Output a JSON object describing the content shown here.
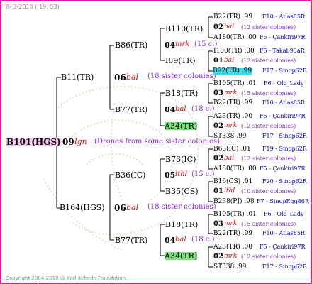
{
  "header_text": "8- 3-2010 ( 19: 53)",
  "footer_text": "Copyright 2004-2010 @ Karl Kehede Foundation.",
  "root": {
    "label": "B101(HGS)",
    "mate_num": "09",
    "mate_mark": "lgn",
    "mate_note": "(Drones from some sister colonies)"
  },
  "gen1": [
    {
      "label": "B11(TR)",
      "mate_num": "06",
      "mate_mark": "bal",
      "mate_note": "(18 sister colonies)"
    },
    {
      "label": "B164(HGS)",
      "mate_num": "06",
      "mate_mark": "bal",
      "mate_note": "(18 sister colonies)"
    }
  ],
  "gen2": [
    {
      "label": "B86(TR)",
      "mate_num": "04",
      "mate_mark": "mrk",
      "mate_note": "(15 c.)"
    },
    {
      "label": "B77(TR)",
      "mate_num": "04",
      "mate_mark": "bal",
      "mate_note": "(18 c.)"
    },
    {
      "label": "B36(IC)",
      "mate_num": "05",
      "mate_mark": "lthl",
      "mate_note": "(15 c.)"
    },
    {
      "label": "B77(TR)",
      "mate_num": "04",
      "mate_mark": "bal",
      "mate_note": "(18 c.)"
    }
  ],
  "gen3": [
    {
      "label": "B110(TR)",
      "mate_num": "02",
      "mate_mark": "bal",
      "mate_note": "(12 sister colonies)"
    },
    {
      "label": "I89(TR)",
      "mate_num": "01",
      "mate_mark": "bal",
      "mate_note": "(12 sister colonies)"
    },
    {
      "label": "B18(TR)",
      "mate_num": "03",
      "mate_mark": "mrk",
      "mate_note": "(15 sister colonies)"
    },
    {
      "label": "A34(TR)",
      "mate_num": "02",
      "mate_mark": "mrk",
      "mate_note": "(12 sister colonies)"
    },
    {
      "label": "B73(IC)",
      "mate_num": "02",
      "mate_mark": "bal",
      "mate_note": "(12 sister colonies)"
    },
    {
      "label": "B35(CS)",
      "mate_num": "01",
      "mate_mark": "lthl",
      "mate_note": "(10 sister colonies)"
    },
    {
      "label": "B18(TR)",
      "mate_num": "03",
      "mate_mark": "mrk",
      "mate_note": "(15 sister colonies)"
    },
    {
      "label": "A34(TR)",
      "mate_num": "02",
      "mate_mark": "mrk",
      "mate_note": "(12 sister colonies)"
    }
  ],
  "gen4": [
    {
      "id": "B22(TR) .99",
      "loc": "F10 - Atlas85R"
    },
    {
      "id": "A180(TR) .00",
      "loc": "F5 - Çankiri97R"
    },
    {
      "id": "I100(TR) .00",
      "loc": "F5 - Takab93aR"
    },
    {
      "id": "B92(TR) .99",
      "loc": "F17 - Sinop62R"
    },
    {
      "id": "B105(TR) .01",
      "loc": "F6 - Old_Lady"
    },
    {
      "id": "B22(TR) .99",
      "loc": "F10 - Atlas85R"
    },
    {
      "id": "A23(TR) .00",
      "loc": "F5 - Çankiri97R"
    },
    {
      "id": "ST338 .99",
      "loc": "F17 - Sinop62R"
    },
    {
      "id": "B63(IC) .01",
      "loc": "F19 - Sinop62R"
    },
    {
      "id": "A180(TR) .00",
      "loc": "F5 - Çankiri97R"
    },
    {
      "id": "B16(CS) .01",
      "loc": "F20 - Sinop62R"
    },
    {
      "id": "B238(PJ) .98",
      "loc": "F7 - SinopEgg86R"
    },
    {
      "id": "B105(TR) .01",
      "loc": "F6 - Old_Lady"
    },
    {
      "id": "B22(TR) .99",
      "loc": "F10 - Atlas85R"
    },
    {
      "id": "A23(TR) .00",
      "loc": "F5 - Çankiri97R"
    },
    {
      "id": "ST338 .99",
      "loc": "F17 - Sinop62R"
    }
  ]
}
